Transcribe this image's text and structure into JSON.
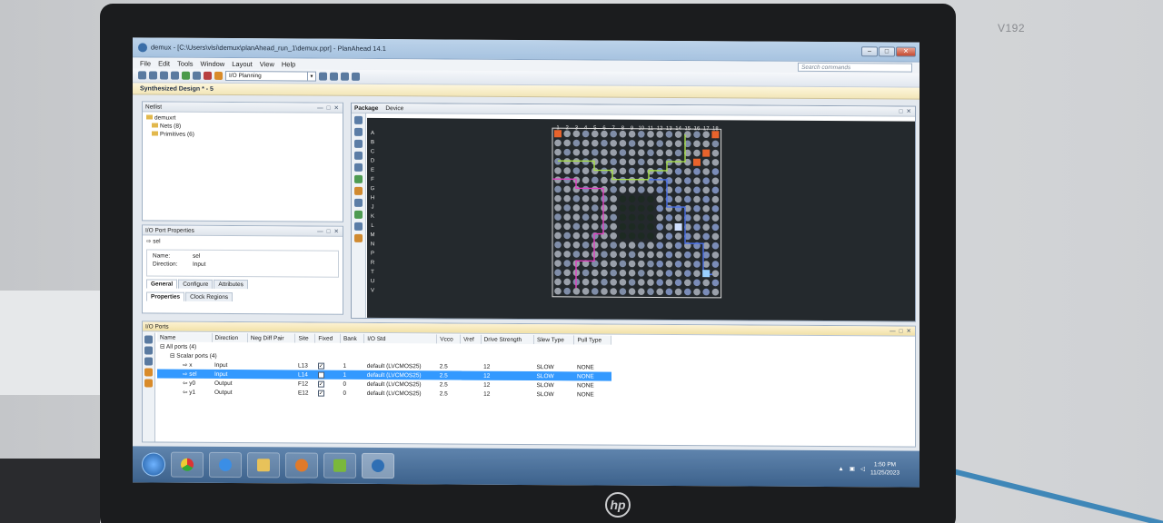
{
  "monitor": {
    "model": "V192",
    "brand": "hp"
  },
  "window": {
    "title": "demux - [C:\\Users\\vlsi\\demux\\planAhead_run_1\\demux.ppr] - PlanAhead 14.1",
    "min_label": "–",
    "max_label": "□",
    "close_label": "✕"
  },
  "menu": [
    "File",
    "Edit",
    "Tools",
    "Window",
    "Layout",
    "View",
    "Help"
  ],
  "search": {
    "placeholder": "Search commands"
  },
  "toolbar": {
    "layout_value": "I/O Planning"
  },
  "design_bar": {
    "label": "Synthesized Design * - 5"
  },
  "netlist": {
    "title": "Netlist",
    "root": "demuxrt",
    "nets": "Nets (8)",
    "primitives": "Primitives (6)"
  },
  "io_port_props": {
    "title": "I/O Port Properties",
    "port": "sel",
    "name_key": "Name:",
    "name_val": "sel",
    "dir_key": "Direction:",
    "dir_val": "Input",
    "tabs": [
      "General",
      "Configure",
      "Attributes"
    ],
    "bottom_tabs": [
      "Properties",
      "Clock Regions"
    ]
  },
  "package": {
    "tabs": [
      "Package",
      "Device"
    ],
    "col_labels": [
      "1",
      "2",
      "3",
      "4",
      "5",
      "6",
      "7",
      "8",
      "9",
      "10",
      "11",
      "12",
      "13",
      "14",
      "15",
      "16",
      "17",
      "18"
    ],
    "row_labels": [
      "A",
      "B",
      "C",
      "D",
      "E",
      "F",
      "G",
      "H",
      "J",
      "K",
      "L",
      "M",
      "N",
      "P",
      "R",
      "T",
      "U",
      "V"
    ]
  },
  "io_ports": {
    "title": "I/O Ports",
    "headers": [
      "Name",
      "Direction",
      "Neg Diff Pair",
      "Site",
      "Fixed",
      "Bank",
      "I/O Std",
      "Vcco",
      "Vref",
      "Drive Strength",
      "Slew Type",
      "Pull Type"
    ],
    "all_ports": "All ports (4)",
    "scalar_ports": "Scalar ports (4)",
    "rows": [
      {
        "name": "x",
        "direction": "Input",
        "site": "L13",
        "fixed": "✓",
        "bank": "1",
        "iostd": "default (LVCMOS25)",
        "vcco": "2.5",
        "drive": "12",
        "slew": "SLOW",
        "pull": "NONE"
      },
      {
        "name": "sel",
        "direction": "Input",
        "site": "L14",
        "fixed": "✓",
        "bank": "1",
        "iostd": "default (LVCMOS25)",
        "vcco": "2.5",
        "drive": "12",
        "slew": "SLOW",
        "pull": "NONE"
      },
      {
        "name": "y0",
        "direction": "Output",
        "site": "F12",
        "fixed": "✓",
        "bank": "0",
        "iostd": "default (LVCMOS25)",
        "vcco": "2.5",
        "drive": "12",
        "slew": "SLOW",
        "pull": "NONE"
      },
      {
        "name": "y1",
        "direction": "Output",
        "site": "E12",
        "fixed": "✓",
        "bank": "0",
        "iostd": "default (LVCMOS25)",
        "vcco": "2.5",
        "drive": "12",
        "slew": "SLOW",
        "pull": "NONE"
      }
    ]
  },
  "taskbar": {
    "time": "1:50 PM",
    "date": "11/25/2023"
  },
  "colors": {
    "selection": "#3399ff",
    "taskbar": "#4a6f99",
    "package_bg": "#24292d"
  }
}
